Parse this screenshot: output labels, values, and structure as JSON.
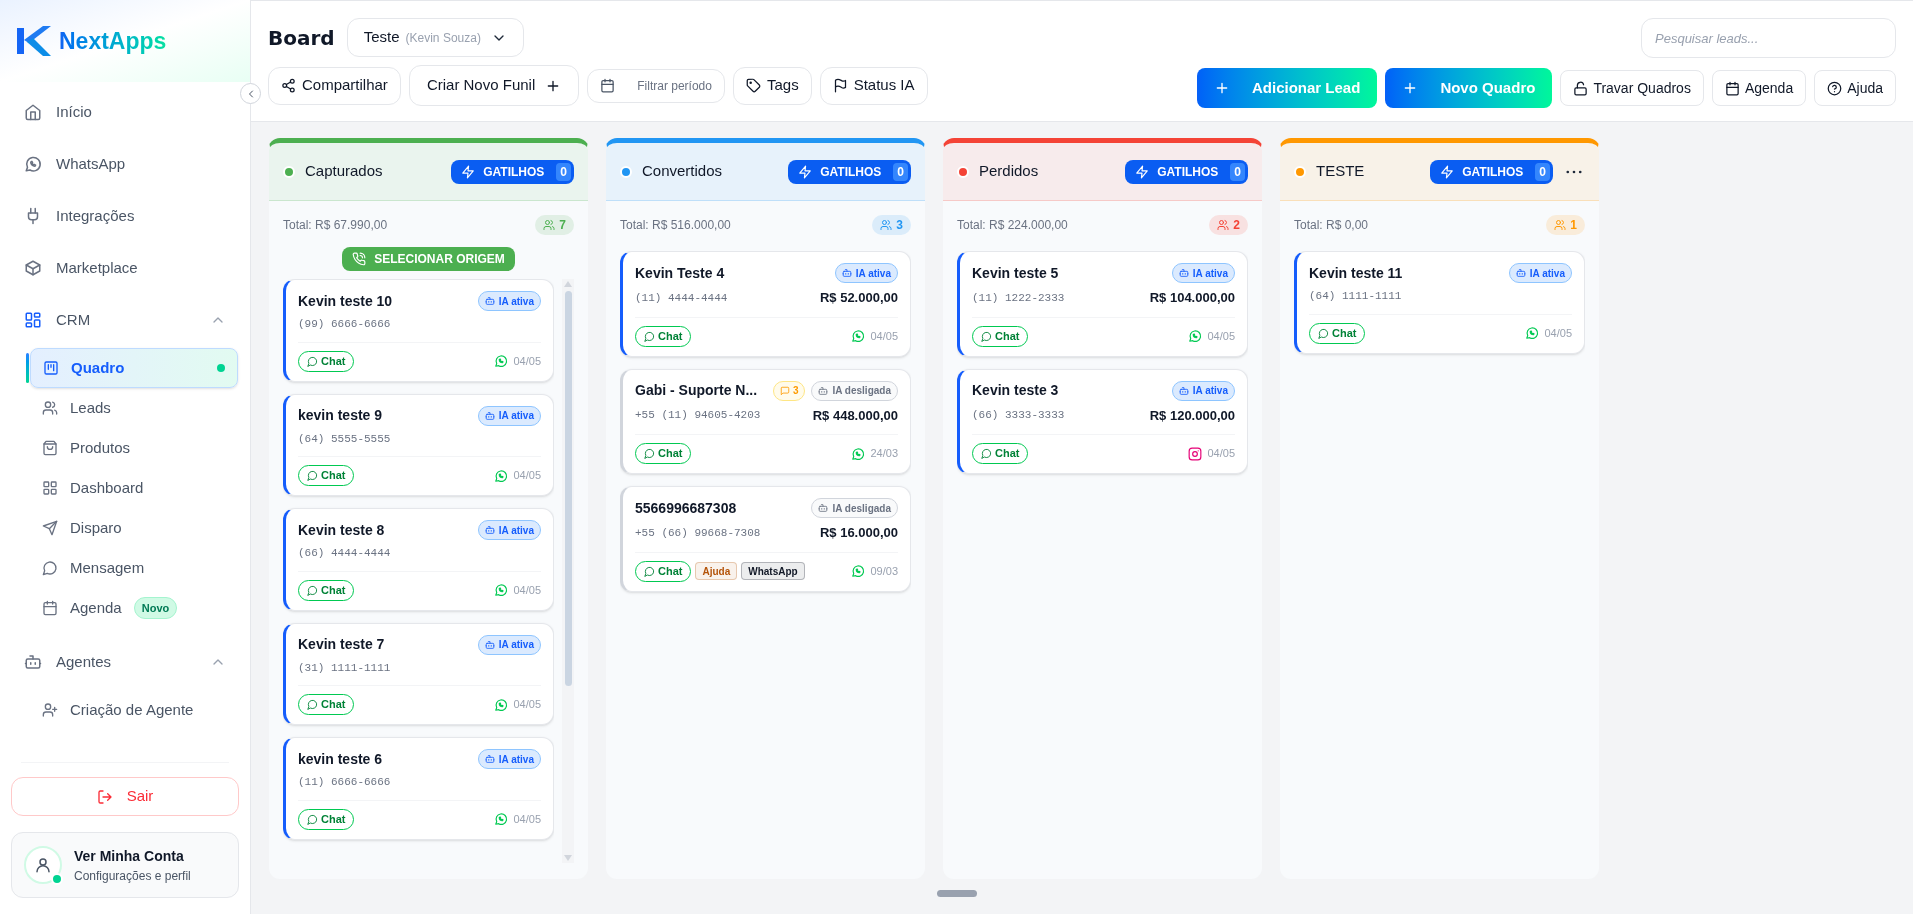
{
  "sidebar": {
    "logo": "NextApps",
    "items": [
      {
        "label": "Início",
        "selected": false
      },
      {
        "label": "WhatsApp",
        "selected": false
      },
      {
        "label": "Integrações",
        "selected": false
      },
      {
        "label": "Marketplace",
        "selected": false
      },
      {
        "label": "CRM",
        "selected": false,
        "expanded": true,
        "children": [
          {
            "label": "Quadro",
            "selected": true
          },
          {
            "label": "Leads",
            "selected": false
          },
          {
            "label": "Produtos",
            "selected": false
          },
          {
            "label": "Dashboard",
            "selected": false
          },
          {
            "label": "Disparo",
            "selected": false
          },
          {
            "label": "Mensagem",
            "selected": false
          },
          {
            "label": "Agenda",
            "selected": false,
            "badge": "Novo"
          }
        ]
      },
      {
        "label": "Agentes",
        "selected": false,
        "expanded": true,
        "children": [
          {
            "label": "Criação de Agente",
            "selected": false
          }
        ]
      }
    ],
    "logout": "Sair",
    "account": {
      "name": "Ver Minha Conta",
      "subtitle": "Configurações e perfil",
      "online": true
    }
  },
  "header": {
    "title": "Board",
    "board_select": {
      "value": "Teste",
      "owner": "(Kevin Souza)"
    },
    "toolbar": [
      {
        "label": "Compartilhar",
        "kind": "button"
      },
      {
        "label": "Criar Novo Funil",
        "kind": "trailing"
      },
      {
        "label": "Filtrar período",
        "kind": "date_filter"
      },
      {
        "label": "Tags",
        "kind": "button"
      },
      {
        "label": "Status IA",
        "kind": "button"
      }
    ],
    "search": {
      "placeholder": "Pesquisar leads..."
    },
    "actions": [
      {
        "label": "Adicionar Lead",
        "kind": "primary"
      },
      {
        "label": "Novo Quadro",
        "kind": "primary"
      },
      {
        "label": "Travar Quadros",
        "kind": "outline"
      },
      {
        "label": "Agenda",
        "kind": "outline"
      },
      {
        "label": "Ajuda",
        "kind": "outline"
      }
    ]
  },
  "columns": [
    {
      "title": "Capturados",
      "color": "#4caf50",
      "triggers_label": "GATILHOS",
      "triggers_count": "0",
      "total": "Total: R$ 67.990,00",
      "count": "7",
      "origin_button": "SELECIONAR ORIGEM",
      "scrollable": true,
      "cards": [
        {
          "name": "Kevin teste 10",
          "phone": "(99) 6666-6666",
          "ai_label": "IA ativa",
          "ai_active": true,
          "chat_label": "Chat",
          "kind": "whatsapp",
          "date": "04/05"
        },
        {
          "name": "kevin teste 9",
          "phone": "(64) 5555-5555",
          "ai_label": "IA ativa",
          "ai_active": true,
          "chat_label": "Chat",
          "kind": "whatsapp",
          "date": "04/05"
        },
        {
          "name": "Kevin teste 8",
          "phone": "(66) 4444-4444",
          "ai_label": "IA ativa",
          "ai_active": true,
          "chat_label": "Chat",
          "kind": "whatsapp",
          "date": "04/05"
        },
        {
          "name": "Kevin teste 7",
          "phone": "(31) 1111-1111",
          "ai_label": "IA ativa",
          "ai_active": true,
          "chat_label": "Chat",
          "kind": "whatsapp",
          "date": "04/05"
        },
        {
          "name": "kevin teste 6",
          "phone": "(11) 6666-6666",
          "ai_label": "IA ativa",
          "ai_active": true,
          "chat_label": "Chat",
          "kind": "whatsapp",
          "date": "04/05"
        }
      ]
    },
    {
      "title": "Convertidos",
      "color": "#2196f3",
      "triggers_label": "GATILHOS",
      "triggers_count": "0",
      "total": "Total: R$ 516.000,00",
      "count": "3",
      "cards": [
        {
          "name": "Kevin Teste 4",
          "phone": "(11) 4444-4444",
          "value": "R$ 52.000,00",
          "ai_label": "IA ativa",
          "ai_active": true,
          "chat_label": "Chat",
          "kind": "whatsapp",
          "date": "04/05"
        },
        {
          "name": "Gabi - Suporte N...",
          "messages": "3",
          "phone": "+55 (11) 94605-4203",
          "value": "R$ 448.000,00",
          "ai_label": "IA desligada",
          "ai_active": false,
          "chat_label": "Chat",
          "kind": "whatsapp",
          "date": "24/03"
        },
        {
          "name": "5566996687308",
          "phone": "+55 (66) 99668-7308",
          "value": "R$ 16.000,00",
          "ai_label": "IA desligada",
          "ai_active": false,
          "chat_label": "Chat",
          "tags": [
            {
              "label": "Ajuda",
              "color": "#b45309"
            },
            {
              "label": "WhatsApp",
              "color": "#111827"
            }
          ],
          "kind": "whatsapp",
          "date": "09/03"
        }
      ]
    },
    {
      "title": "Perdidos",
      "color": "#f44336",
      "triggers_label": "GATILHOS",
      "triggers_count": "0",
      "total": "Total: R$ 224.000,00",
      "count": "2",
      "cards": [
        {
          "name": "Kevin teste 5",
          "phone": "(11) 1222-2333",
          "value": "R$ 104.000,00",
          "ai_label": "IA ativa",
          "ai_active": true,
          "chat_label": "Chat",
          "kind": "whatsapp",
          "date": "04/05"
        },
        {
          "name": "Kevin teste 3",
          "phone": "(66) 3333-3333",
          "value": "R$ 120.000,00",
          "ai_label": "IA ativa",
          "ai_active": true,
          "chat_label": "Chat",
          "kind": "instagram",
          "date": "04/05"
        }
      ]
    },
    {
      "title": "TESTE",
      "color": "#ff9800",
      "triggers_label": "GATILHOS",
      "triggers_count": "0",
      "menu": true,
      "total": "Total: R$ 0,00",
      "count": "1",
      "cards": [
        {
          "name": "Kevin teste 11",
          "phone": "(64) 1111-1111",
          "ai_label": "IA ativa",
          "ai_active": true,
          "chat_label": "Chat",
          "kind": "whatsapp",
          "date": "04/05"
        }
      ]
    }
  ]
}
